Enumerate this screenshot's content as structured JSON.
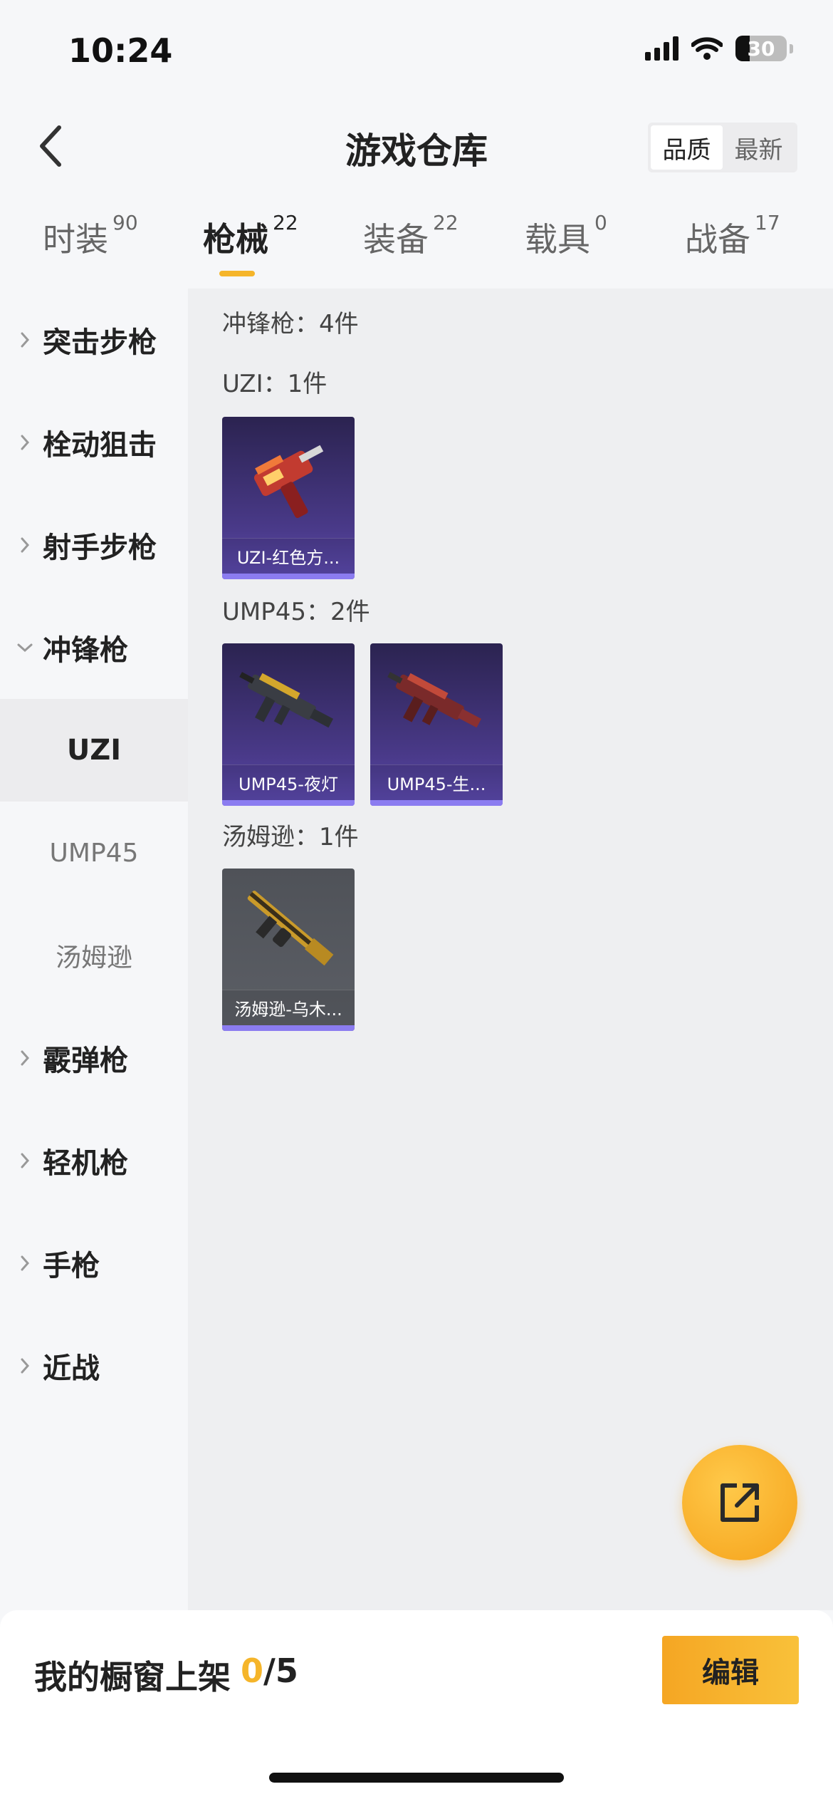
{
  "status": {
    "time": "10:24",
    "battery": "30"
  },
  "header": {
    "title": "游戏仓库",
    "sort_options": [
      "品质",
      "最新"
    ]
  },
  "tabs": [
    {
      "label": "时装",
      "count": "90"
    },
    {
      "label": "枪械",
      "count": "22"
    },
    {
      "label": "装备",
      "count": "22"
    },
    {
      "label": "载具",
      "count": "0"
    },
    {
      "label": "战备",
      "count": "17"
    }
  ],
  "sidebar": {
    "items": [
      {
        "label": "突击步枪"
      },
      {
        "label": "栓动狙击"
      },
      {
        "label": "射手步枪"
      },
      {
        "label": "冲锋枪"
      },
      {
        "label": "霰弹枪"
      },
      {
        "label": "轻机枪"
      },
      {
        "label": "手枪"
      },
      {
        "label": "近战"
      }
    ],
    "sub_items": [
      {
        "label": "UZI"
      },
      {
        "label": "UMP45"
      },
      {
        "label": "汤姆逊"
      }
    ]
  },
  "content": {
    "category_header": "冲锋枪：4件",
    "groups": [
      {
        "title": "UZI：1件",
        "items": [
          {
            "name": "UZI-红色方..."
          }
        ]
      },
      {
        "title": "UMP45：2件",
        "items": [
          {
            "name": "UMP45-夜灯"
          },
          {
            "name": "UMP45-生..."
          }
        ]
      },
      {
        "title": "汤姆逊：1件",
        "items": [
          {
            "name": "汤姆逊-乌木..."
          }
        ]
      }
    ]
  },
  "footer": {
    "shelf_label": "我的橱窗上架",
    "shelf_current": "0",
    "shelf_total": "/5",
    "edit_label": "编辑"
  },
  "colors": {
    "accent": "#f5b52a",
    "card_purple": "#4a3a8a",
    "card_gray": "#5c5f66"
  }
}
